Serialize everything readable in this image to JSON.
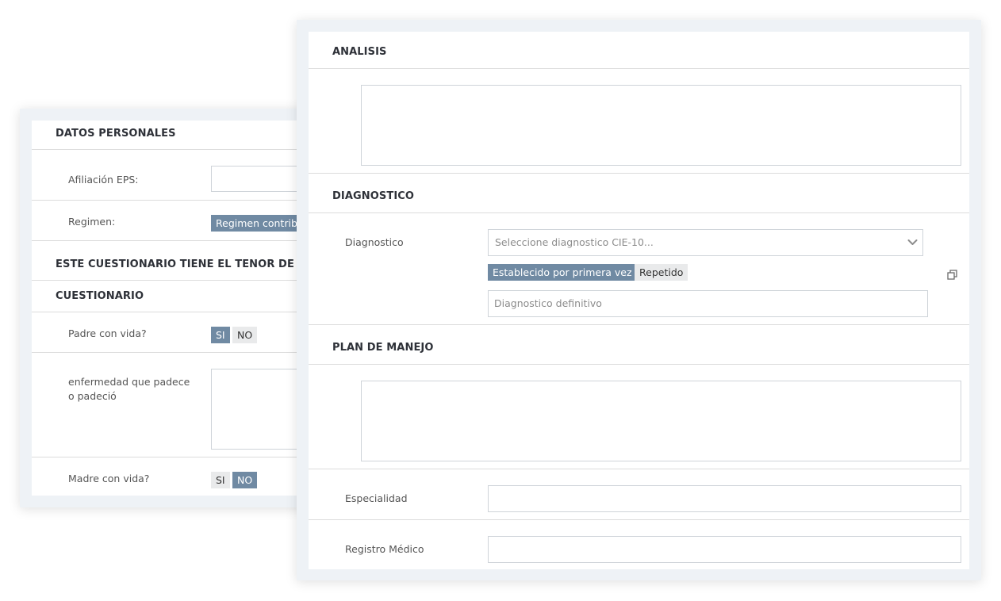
{
  "back_card": {
    "section_personal": "DATOS PERSONALES",
    "eps_label": "Afiliación EPS:",
    "regimen_label": "Regimen:",
    "regimen_selected": "Regimen contrib",
    "notice": "ESTE CUESTIONARIO TIENE EL TENOR DE UN",
    "section_questionnaire": "CUESTIONARIO",
    "father_label": "Padre con vida?",
    "father_options": [
      "SI",
      "NO"
    ],
    "father_selected": "SI",
    "disease_label": "enfermedad que padece o padeció",
    "mother_label": "Madre con vida?",
    "mother_options": [
      "SI",
      "NO"
    ],
    "mother_selected": "NO"
  },
  "front_card": {
    "section_analysis": "ANALISIS",
    "section_diagnosis": "DIAGNOSTICO",
    "diagnosis_label": "Diagnostico",
    "diagnosis_placeholder": "Seleccione diagnostico CIE-10...",
    "diagnosis_type_options": [
      "Establecido por primera vez",
      "Repetido"
    ],
    "diagnosis_type_selected": "Establecido por primera vez",
    "definitive_placeholder": "Diagnostico definitivo",
    "section_plan": "PLAN DE MANEJO",
    "specialty_label": "Especialidad",
    "record_label": "Registro Médico"
  },
  "icons": {
    "chevron": "chevron-down-icon",
    "expand": "external-window-icon"
  },
  "colors": {
    "selected_tag": "#708aa3",
    "unselected_tag": "#e9eaeb",
    "card_frame": "#eef2f6"
  }
}
